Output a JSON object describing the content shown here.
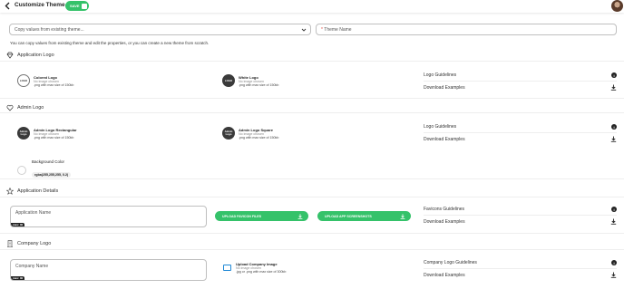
{
  "header": {
    "title": "Customize Theme",
    "save_label": "SAVE"
  },
  "copy_select": {
    "placeholder": "Copy values from existing theme..."
  },
  "theme_name": {
    "required_mark": "*",
    "placeholder": "Theme Name"
  },
  "hint": "You can copy values from existing theme and edit the properties, or you can create a new theme from scratch.",
  "sections": {
    "application_logo": {
      "title": "Application Logo",
      "colored": {
        "badge": "LOGO",
        "title": "Colored Logo",
        "status": "No image chosen",
        "format": ".png with max size of 150kb"
      },
      "white": {
        "badge": "LOGO",
        "title": "White Logo",
        "status": "No image chosen",
        "format": ".png with max size of 150kb"
      },
      "guidelines": "Logo Guidelines",
      "download": "Download Examples"
    },
    "admin_logo": {
      "title": "Admin Logo",
      "rect": {
        "badge": "Admin Logo",
        "title": "Admin Logo Rectangular",
        "status": "No image chosen",
        "format": ".png with max size of 150kb"
      },
      "square": {
        "badge": "Admin Logo",
        "title": "Admin Logo Square",
        "status": "No image chosen",
        "format": ".png with max size of 150kb"
      },
      "guidelines": "Logo Guidelines",
      "download": "Download Examples",
      "bg_label": "Background Color",
      "bg_value": "rgba(255,255,255, 0.2)"
    },
    "application_details": {
      "title": "Application Details",
      "name_placeholder": "Application Name",
      "max_badge": "max: 30",
      "favicon_button": "UPLOAD FAVICON FILES",
      "screenshots_button": "UPLOAD APP SCREENSHOTS",
      "guidelines": "Favicons Guidelines",
      "download": "Download Examples"
    },
    "company_logo": {
      "title": "Company Logo",
      "name_placeholder": "Company Name",
      "max_badge": "max: 30",
      "upload_title": "Upload Company Image",
      "upload_status": "No image chosen",
      "upload_format": ".jpg or .png with max size of 300kb",
      "guidelines": "Company Logo Guidelines",
      "download": "Download Examples"
    }
  },
  "colors": {
    "accent": "#35c26a",
    "required": "#e0453b",
    "link": "#1e88d6"
  }
}
